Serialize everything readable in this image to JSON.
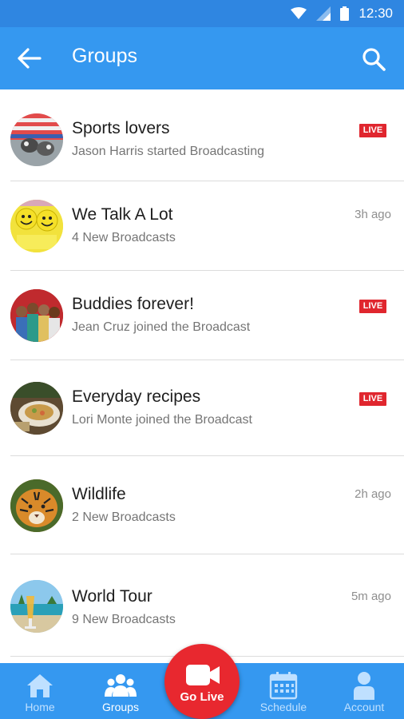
{
  "status_bar": {
    "time": "12:30"
  },
  "app_bar": {
    "title": "Groups"
  },
  "groups": [
    {
      "name": "Sports lovers",
      "subtitle": "Jason Harris started Broadcasting",
      "live_badge": "LIVE",
      "time": null,
      "avatar": "sports-avatar"
    },
    {
      "name": "We Talk A Lot",
      "subtitle": "4 New Broadcasts",
      "live_badge": null,
      "time": "3h ago",
      "avatar": "smileys-avatar"
    },
    {
      "name": "Buddies forever!",
      "subtitle": "Jean Cruz joined the Broadcast",
      "live_badge": "LIVE",
      "time": null,
      "avatar": "friends-avatar"
    },
    {
      "name": "Everyday recipes",
      "subtitle": "Lori Monte joined the Broadcast",
      "live_badge": "LIVE",
      "time": null,
      "avatar": "food-avatar"
    },
    {
      "name": "Wildlife",
      "subtitle": "2 New Broadcasts",
      "live_badge": null,
      "time": "2h ago",
      "avatar": "tiger-avatar"
    },
    {
      "name": "World Tour",
      "subtitle": "9 New Broadcasts",
      "live_badge": null,
      "time": "5m ago",
      "avatar": "beach-avatar"
    }
  ],
  "bottom_nav": {
    "home": "Home",
    "groups": "Groups",
    "go_live": "Go Live",
    "schedule": "Schedule",
    "account": "Account"
  },
  "colors": {
    "primary": "#3598f0",
    "status_bar": "#2f86e1",
    "live_red": "#e0262e",
    "go_live_red": "#e8282f"
  }
}
